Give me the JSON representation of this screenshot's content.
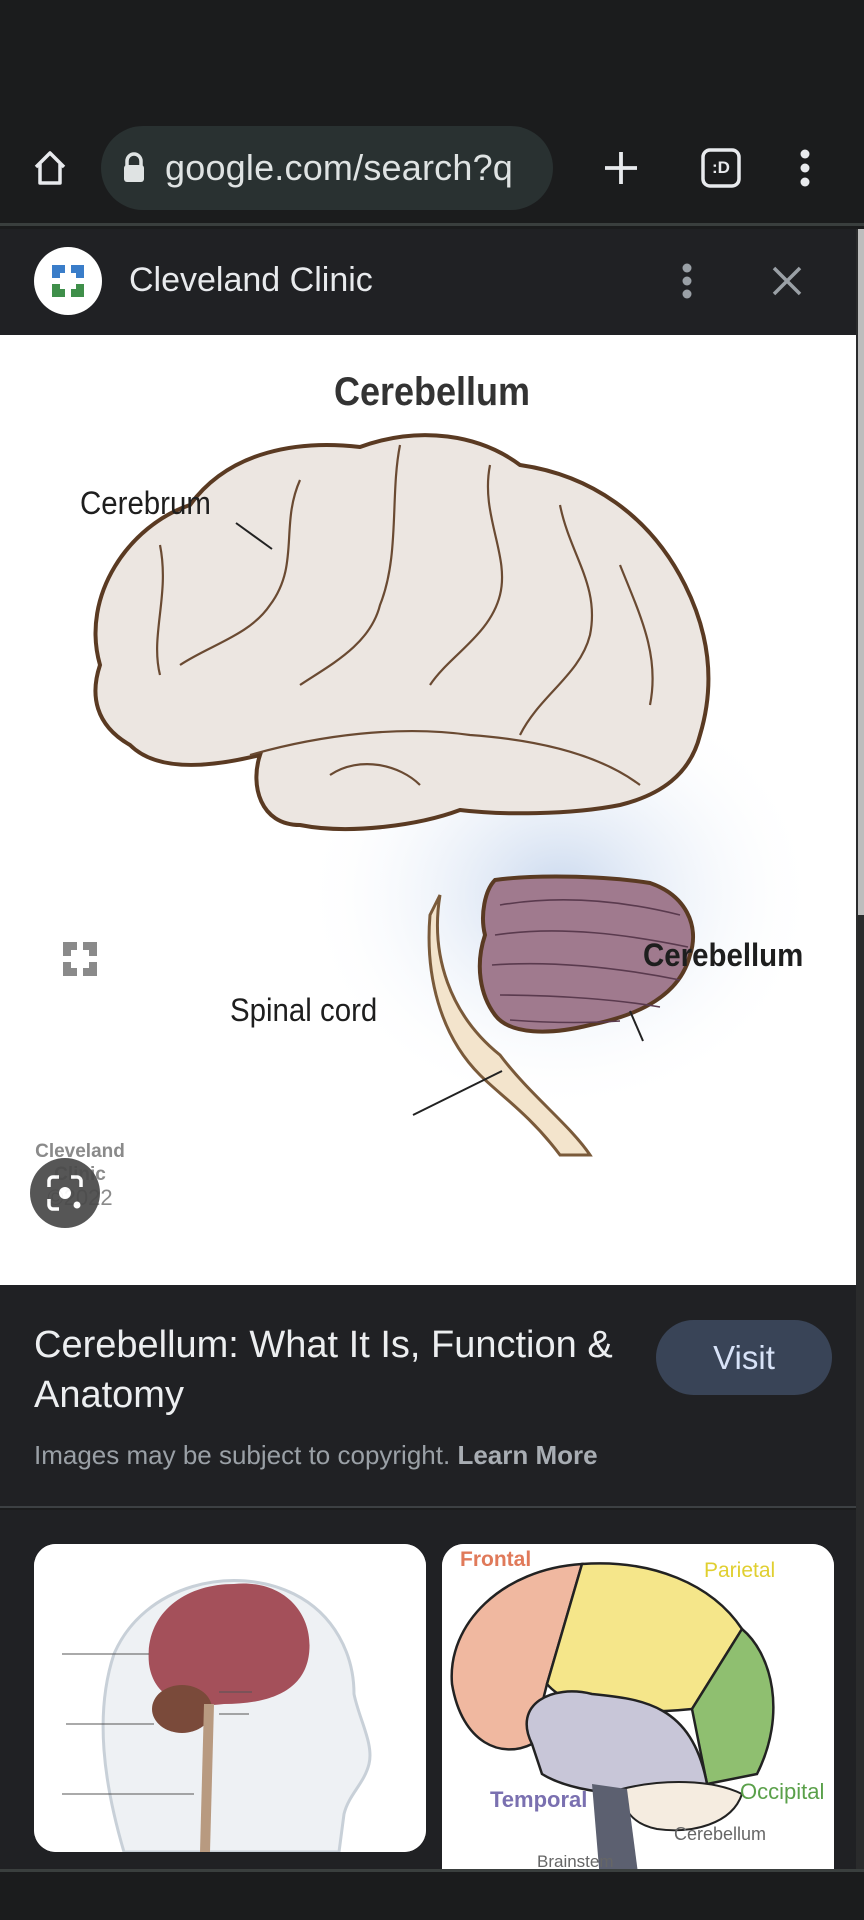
{
  "browser": {
    "url": "google.com/search?q",
    "tab_count_glyph": ":D",
    "icons": {
      "home": "home-icon",
      "lock": "lock-icon",
      "new_tab": "plus-icon",
      "tabs": "tab-switcher-icon",
      "menu": "more-vert-icon"
    }
  },
  "custom_tab": {
    "site_name": "Cleveland Clinic",
    "icons": {
      "menu": "more-vert-icon",
      "close": "close-icon"
    }
  },
  "main_image": {
    "title": "Cerebellum",
    "labels": {
      "cerebrum": "Cerebrum",
      "cerebellum": "Cerebellum",
      "spinal_cord": "Spinal cord"
    },
    "watermark": {
      "line1": "Cleveland",
      "line2": "Clinic",
      "line3": "©2022"
    },
    "colors": {
      "cerebrum_fill": "#ece6e1",
      "outline": "#5a3a22",
      "cerebellum_fill": "#a07a8e",
      "brainstem_fill": "#f3e4cc"
    }
  },
  "result": {
    "title": "Cerebellum: What It Is, Function & Anatomy",
    "visit_label": "Visit",
    "copyright_text": "Images may be subject to copyright.",
    "learn_more_label": "Learn More"
  },
  "related": [
    {
      "alt": "Brain inside head profile with cerebrum, cerebellum, pons, medulla oblongata, brain stem and spinal cord labels"
    },
    {
      "alt": "Brain lobes diagram",
      "labels": {
        "frontal": "Frontal",
        "parietal": "Parietal",
        "temporal": "Temporal",
        "occipital": "Occipital",
        "cerebellum": "Cerebellum",
        "brainstem": "Brainstem"
      },
      "colors": {
        "frontal": "#e07a5a",
        "parietal": "#e9d94a",
        "temporal": "#7a70b0",
        "occipital": "#5aa04a",
        "cerebellum": "#777777"
      }
    }
  ]
}
